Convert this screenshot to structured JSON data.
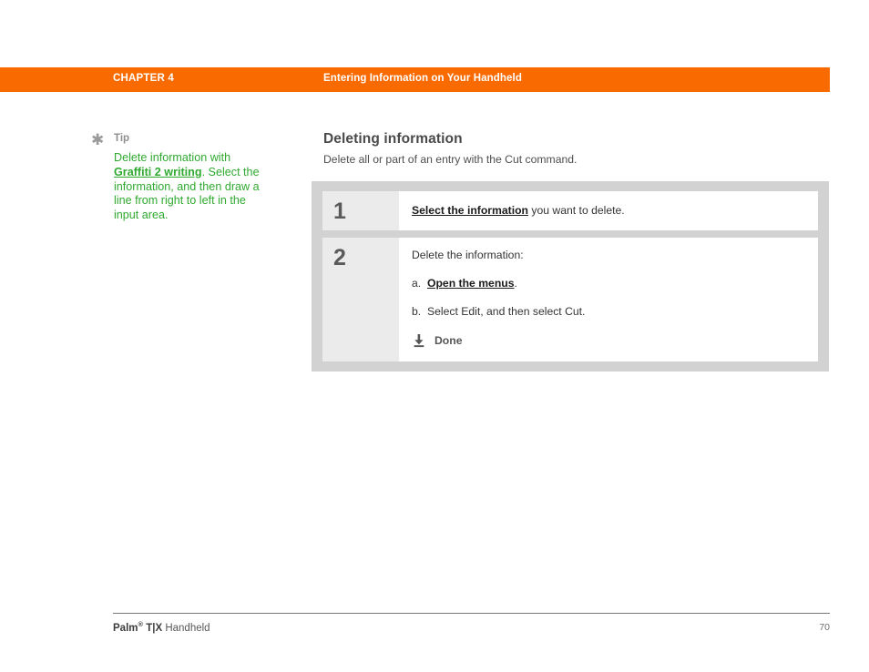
{
  "header": {
    "chapter": "CHAPTER 4",
    "title": "Entering Information on Your Handheld",
    "background_color": "#f96a00",
    "text_color": "#ffffff"
  },
  "tip": {
    "icon": "asterisk-icon",
    "label": "Tip",
    "label_color": "#8e8e8e",
    "text_color": "#2faa2f",
    "text_part1": "Delete information with ",
    "link": "Graffiti 2 writing",
    "text_part2": ". Select the information, and then draw a line from right to left in the input area."
  },
  "main": {
    "section_title": "Deleting information",
    "section_subtitle": "Delete all or part of an entry with the Cut command."
  },
  "steps": {
    "panel_color": "#d2d2d2",
    "number_cell_color": "#ebebeb",
    "items": [
      {
        "number": "1",
        "link": "Select the information",
        "text_after_link": " you want to delete."
      },
      {
        "number": "2",
        "lead": "Delete the information:",
        "sub_items": [
          {
            "marker": "a.",
            "link": "Open the menus",
            "text_after_link": "."
          },
          {
            "marker": "b.",
            "link": "",
            "text_after_link": "Select Edit, and then select Cut."
          }
        ],
        "done": {
          "icon": "download-arrow-icon",
          "label": "Done"
        }
      }
    ]
  },
  "footer": {
    "brand": "Palm",
    "registered_mark": "®",
    "model": " T|X",
    "product": " Handheld",
    "page_number": "70"
  }
}
